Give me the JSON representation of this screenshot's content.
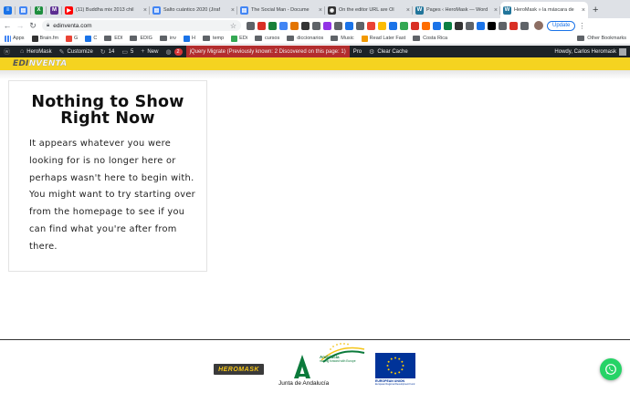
{
  "browser": {
    "tabs": [
      {
        "type": "pinned",
        "color": "#1a73e8",
        "glyph": "≡"
      },
      {
        "type": "pinned",
        "color": "#4285f4",
        "glyph": "▤"
      },
      {
        "type": "pinned",
        "color": "#1e8e3e",
        "glyph": "X"
      },
      {
        "type": "pinned",
        "color": "#5c2d91",
        "glyph": "M"
      },
      {
        "type": "tab",
        "color": "#ff0000",
        "glyph": "▶",
        "title": "(11) Buddha mix 2013 chil"
      },
      {
        "type": "tab",
        "color": "#4285f4",
        "glyph": "▤",
        "title": "Salto cuántico 2020 (Jiraf"
      },
      {
        "type": "tab",
        "color": "#4285f4",
        "glyph": "▤",
        "title": "The Social Man - Docume"
      },
      {
        "type": "tab",
        "color": "#333333",
        "glyph": "◉",
        "title": "On the editor URL are Ol"
      },
      {
        "type": "tab",
        "color": "#21759b",
        "glyph": "W",
        "title": "Pages ‹ HeroMask — Word"
      },
      {
        "type": "tab",
        "color": "#21759b",
        "glyph": "W",
        "title": "HeroMask » la máscara de",
        "active": true
      }
    ],
    "new_tab": "+",
    "url": "edinventa.com",
    "update_label": "Update",
    "extension_colors": [
      "#5f6368",
      "#d93025",
      "#188038",
      "#4285f4",
      "#e37400",
      "#333333",
      "#5f6368",
      "#9334e6",
      "#5f6368",
      "#1a73e8",
      "#5f6368",
      "#ea4335",
      "#fbbc04",
      "#1a73e8",
      "#34a853",
      "#d93025",
      "#ff6d00",
      "#1a73e8",
      "#0b8043",
      "#333333",
      "#5f6368",
      "#1a73e8",
      "#000000",
      "#5f6368",
      "#d93025",
      "#5f6368"
    ]
  },
  "bookmarks": {
    "items": [
      {
        "label": "Apps",
        "kind": "apps",
        "color": "#4285f4"
      },
      {
        "label": "Brain.fm",
        "kind": "site",
        "color": "#333333"
      },
      {
        "label": "G",
        "kind": "site",
        "color": "#ea4335"
      },
      {
        "label": "C",
        "kind": "site",
        "color": "#1a73e8"
      },
      {
        "label": "EDI",
        "kind": "folder"
      },
      {
        "label": "EDIG",
        "kind": "folder"
      },
      {
        "label": "inv",
        "kind": "folder"
      },
      {
        "label": "H",
        "kind": "site",
        "color": "#1a73e8"
      },
      {
        "label": "temp",
        "kind": "folder"
      },
      {
        "label": "EDi",
        "kind": "site",
        "color": "#34a853"
      },
      {
        "label": "cursos",
        "kind": "folder"
      },
      {
        "label": "diccionarios",
        "kind": "folder"
      },
      {
        "label": "Music",
        "kind": "folder"
      },
      {
        "label": "Read Later Fast",
        "kind": "site",
        "color": "#f29900"
      },
      {
        "label": "Costa Rica",
        "kind": "folder"
      }
    ],
    "other": "Other Bookmarks"
  },
  "adminbar": {
    "site_name": "HeroMask",
    "customize": "Customize",
    "updates": "14",
    "comments": "5",
    "new_label": "New",
    "badge_count": "2",
    "jquery": "jQuery Migrate (Previously known: 2 Discovered on this page: 1)",
    "pro": "Pro",
    "clear_cache": "Clear Cache",
    "howdy": "Howdy, Carlos Heromask"
  },
  "site": {
    "logo_part1": "EDI",
    "logo_part2": "NVENTA",
    "header_color": "#f5d320",
    "heading": "Nothing to Show Right Now",
    "message": "It appears whatever you were looking for is no longer here or perhaps wasn't here to begin with. You might want to try starting over from the homepage to see if you can find what you're after from there."
  },
  "footer": {
    "heromask_logo": "HEROMASK",
    "andalucia_tagline_1": "Andalucía",
    "andalucia_tagline_2": "moving forward with Europe",
    "junta": "Junta de Andalucía",
    "eu_title": "EUROPEAN UNION",
    "eu_sub": "European Regional Development Fund"
  }
}
